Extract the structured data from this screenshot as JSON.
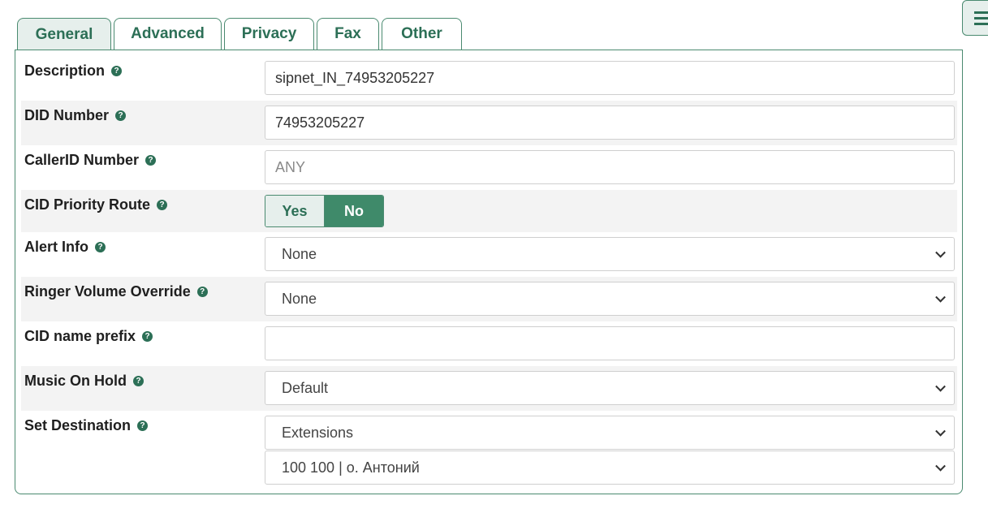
{
  "tabs": [
    {
      "label": "General",
      "active": true
    },
    {
      "label": "Advanced",
      "active": false
    },
    {
      "label": "Privacy",
      "active": false
    },
    {
      "label": "Fax",
      "active": false
    },
    {
      "label": "Other",
      "active": false
    }
  ],
  "form": {
    "description": {
      "label": "Description",
      "value": "sipnet_IN_74953205227"
    },
    "did_number": {
      "label": "DID Number",
      "value": "74953205227"
    },
    "callerid_number": {
      "label": "CallerID Number",
      "value": "",
      "placeholder": "ANY"
    },
    "cid_priority_route": {
      "label": "CID Priority Route",
      "yes_label": "Yes",
      "no_label": "No",
      "selected": "No"
    },
    "alert_info": {
      "label": "Alert Info",
      "value": "None"
    },
    "ringer_volume_override": {
      "label": "Ringer Volume Override",
      "value": "None"
    },
    "cid_name_prefix": {
      "label": "CID name prefix",
      "value": ""
    },
    "music_on_hold": {
      "label": "Music On Hold",
      "value": "Default"
    },
    "set_destination": {
      "label": "Set Destination",
      "type_value": "Extensions",
      "target_value": "100 100 | о. Антоний"
    }
  },
  "help_glyph": "?",
  "icons": {
    "help": "question-circle-icon",
    "side": "list-icon"
  },
  "colors": {
    "accent": "#2c6f56",
    "active_bg": "#e6efec",
    "toggle_on": "#3f8a6a"
  }
}
